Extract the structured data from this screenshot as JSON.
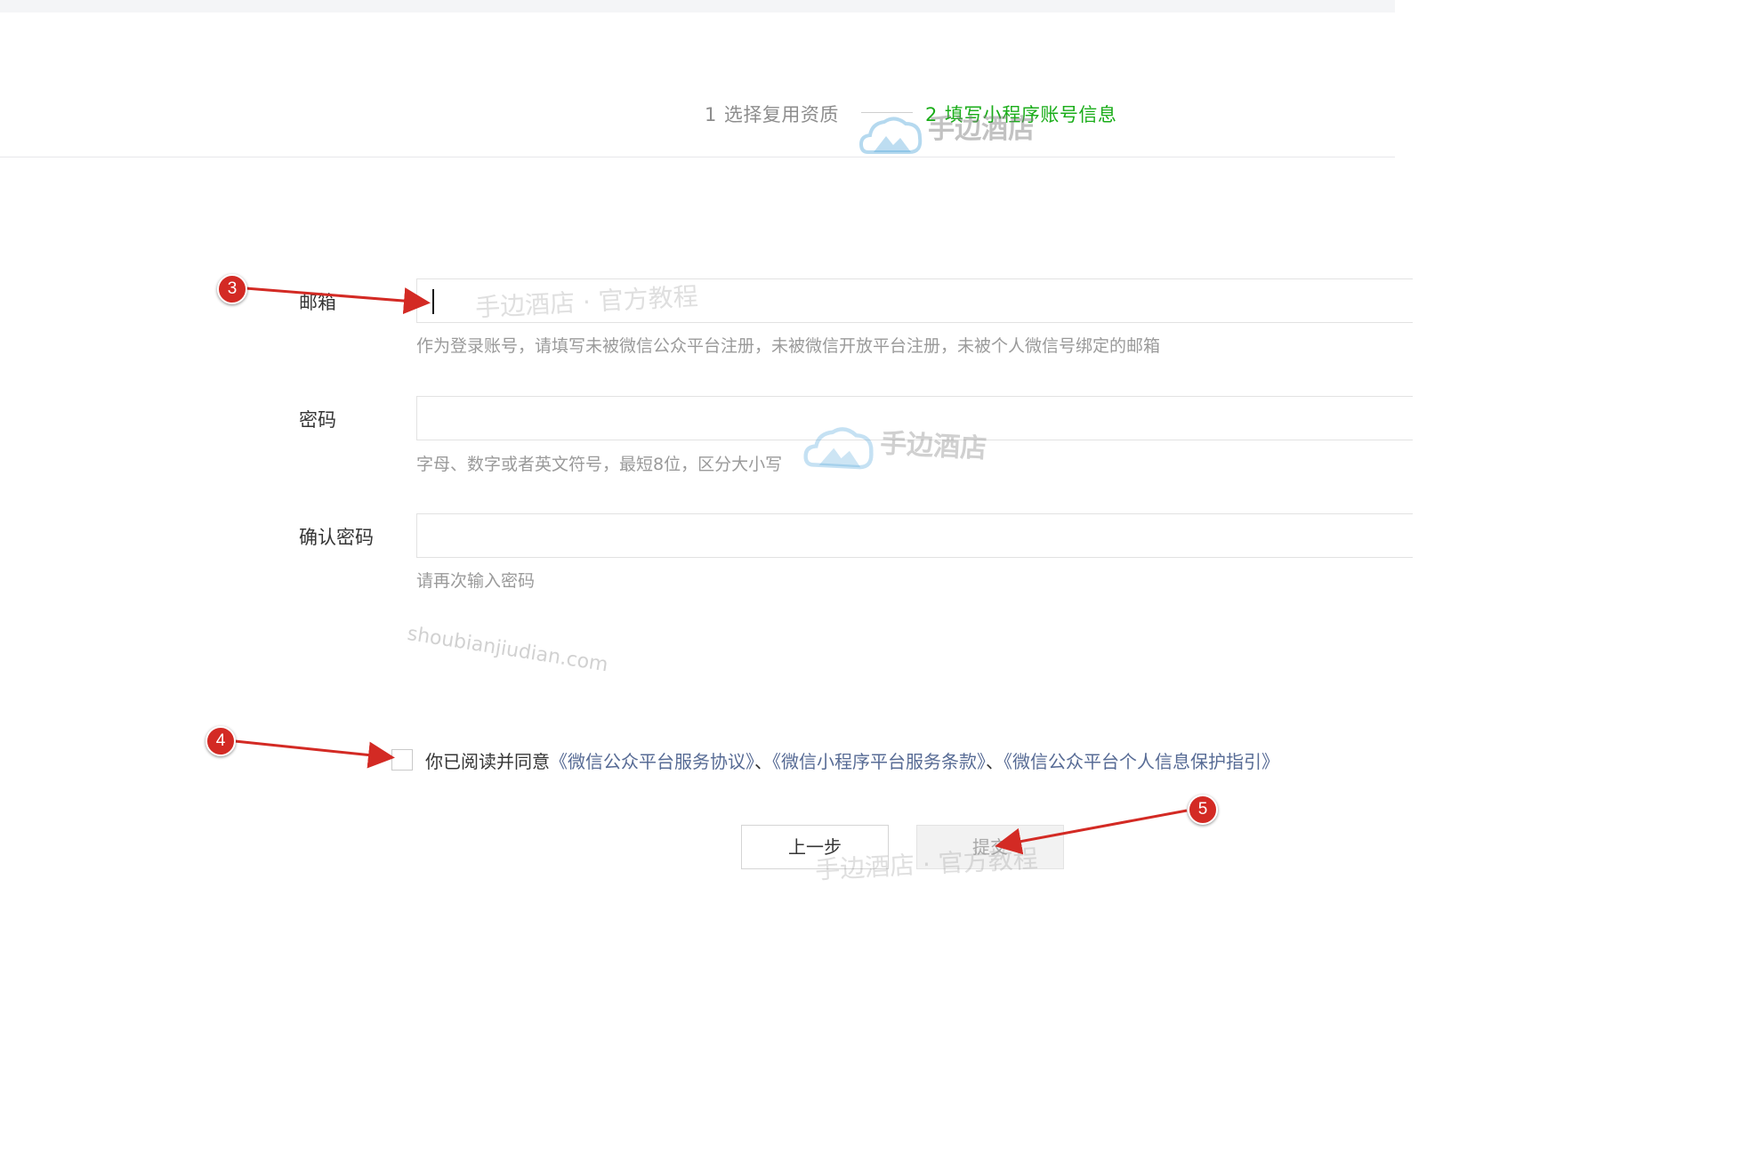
{
  "steps": [
    {
      "num": "1",
      "label": "选择复用资质"
    },
    {
      "num": "2",
      "label": "填写小程序账号信息"
    }
  ],
  "form": {
    "email": {
      "label": "邮箱",
      "value": "",
      "hint": "作为登录账号，请填写未被微信公众平台注册，未被微信开放平台注册，未被个人微信号绑定的邮箱"
    },
    "password": {
      "label": "密码",
      "value": "",
      "hint": "字母、数字或者英文符号，最短8位，区分大小写"
    },
    "confirm": {
      "label": "确认密码",
      "value": "",
      "hint": "请再次输入密码"
    }
  },
  "agreement": {
    "checked": false,
    "prefix": "你已阅读并同意",
    "link1": "《微信公众平台服务协议》",
    "sep1": "、",
    "link2": "《微信小程序平台服务条款》",
    "sep2": "、",
    "link3": "《微信公众平台个人信息保护指引》"
  },
  "buttons": {
    "prev": "上一步",
    "submit": "提交"
  },
  "annotations": [
    "3",
    "4",
    "5"
  ],
  "watermarks": {
    "brand": "手边酒店",
    "tagline": "手边酒店 · 官方教程",
    "url": "shoubianjiudian.com"
  },
  "colors": {
    "active_step": "#1aad19",
    "link": "#576b95",
    "annotation": "#d32a24"
  }
}
